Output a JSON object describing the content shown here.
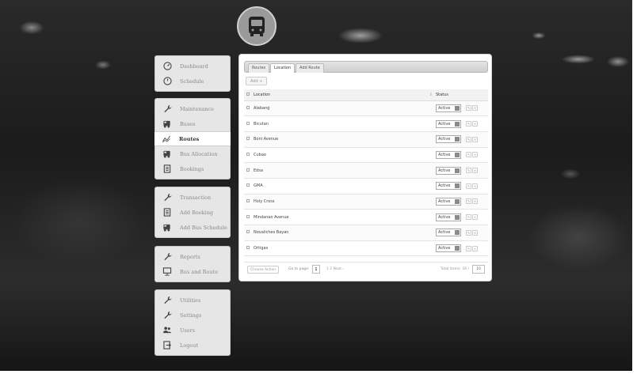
{
  "sidebar": {
    "groups": [
      {
        "items": [
          {
            "label": "Dashboard",
            "icon": "speedometer-icon"
          },
          {
            "label": "Schedule",
            "icon": "clock-icon"
          }
        ]
      },
      {
        "items": [
          {
            "label": "Maintenance",
            "icon": "wrench-icon"
          },
          {
            "label": "Buses",
            "icon": "bus-icon"
          },
          {
            "label": "Routes",
            "icon": "route-chart-icon",
            "active": true
          },
          {
            "label": "Bus Allocation",
            "icon": "bus-icon"
          },
          {
            "label": "Bookings",
            "icon": "clipboard-icon"
          }
        ]
      },
      {
        "items": [
          {
            "label": "Transaction",
            "icon": "wrench-icon"
          },
          {
            "label": "Add Booking",
            "icon": "clipboard-icon"
          },
          {
            "label": "Add Bus Schedule",
            "icon": "bus-icon"
          }
        ]
      },
      {
        "items": [
          {
            "label": "Reports",
            "icon": "wrench-icon"
          },
          {
            "label": "Bus and Route",
            "icon": "presentation-icon"
          }
        ]
      },
      {
        "items": [
          {
            "label": "Utilities",
            "icon": "wrench-icon"
          },
          {
            "label": "Settings",
            "icon": "wrench-icon"
          },
          {
            "label": "Users",
            "icon": "users-icon"
          },
          {
            "label": "Logout",
            "icon": "logout-icon"
          }
        ]
      }
    ]
  },
  "tabs": [
    {
      "label": "Routes"
    },
    {
      "label": "Location",
      "active": true
    },
    {
      "label": "Add Route"
    }
  ],
  "add_button": "Add +",
  "table": {
    "headers": {
      "location": "Location",
      "status": "Status"
    },
    "rows": [
      {
        "location": "Alabang",
        "status": "Active"
      },
      {
        "location": "Bicutan",
        "status": "Active"
      },
      {
        "location": "Boni Avenue",
        "status": "Active"
      },
      {
        "location": "Cubao",
        "status": "Active"
      },
      {
        "location": "Edsa",
        "status": "Active"
      },
      {
        "location": "GMA",
        "status": "Active"
      },
      {
        "location": "Holy Cross",
        "status": "Active"
      },
      {
        "location": "Mindanao Avenue",
        "status": "Active"
      },
      {
        "location": "Novaliches Bayan",
        "status": "Active"
      },
      {
        "location": "Ortigas",
        "status": "Active"
      }
    ]
  },
  "footer": {
    "choose_action": "Choose Action",
    "goto_label": "Go to page:",
    "page_value": "1",
    "pager": "1  2  Next ›",
    "total": "Total items: 16 /",
    "per_page": "10"
  }
}
